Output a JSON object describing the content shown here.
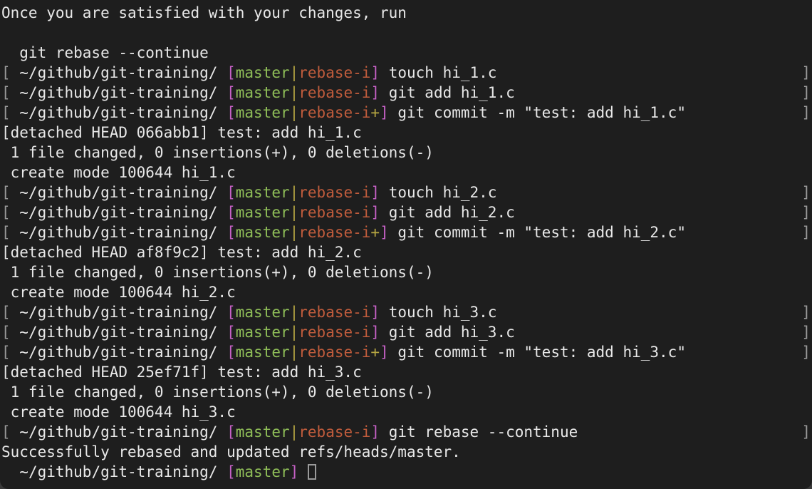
{
  "terminal": {
    "background_color": "#1e1e1e",
    "foreground_color": "#e8e8e8",
    "accent_colors": {
      "bracket_magenta": "#c661c6",
      "branch_green": "#8fbe58",
      "separator_olive": "#b5a642",
      "rebase_rust": "#c05c3c",
      "apple_purple": "#bf55c4",
      "edge_grey": "#9a9a9a"
    },
    "prompt": {
      "left_bracket": "[",
      "apple_icon": "",
      "path": "~/github/git-training/",
      "branch_open": "[",
      "branch": "master",
      "branch_sep": "|",
      "rebase_state": "rebase-i",
      "dirty_marker": "+",
      "branch_close": "]",
      "right_bracket": "]"
    },
    "cursor": "block-cursor",
    "lines": [
      {
        "name": "hint-line-1",
        "kind": "output",
        "text": "Once you are satisfied with your changes, run"
      },
      {
        "name": "blank-line-1",
        "kind": "blank",
        "text": ""
      },
      {
        "name": "hint-command",
        "kind": "output",
        "text": "  git rebase --continue"
      },
      {
        "name": "prompt-touch-1",
        "kind": "prompt",
        "dirty": false,
        "command": "touch hi_1.c"
      },
      {
        "name": "prompt-add-1",
        "kind": "prompt",
        "dirty": false,
        "command": "git add hi_1.c"
      },
      {
        "name": "prompt-commit-1",
        "kind": "prompt",
        "dirty": true,
        "command": "git commit -m \"test: add hi_1.c\""
      },
      {
        "name": "output-detached-1",
        "kind": "output",
        "text": "[detached HEAD 066abb1] test: add hi_1.c"
      },
      {
        "name": "output-changed-1",
        "kind": "output",
        "text": " 1 file changed, 0 insertions(+), 0 deletions(-)"
      },
      {
        "name": "output-createmode-1",
        "kind": "output",
        "text": " create mode 100644 hi_1.c"
      },
      {
        "name": "prompt-touch-2",
        "kind": "prompt",
        "dirty": false,
        "command": "touch hi_2.c"
      },
      {
        "name": "prompt-add-2",
        "kind": "prompt",
        "dirty": false,
        "command": "git add hi_2.c"
      },
      {
        "name": "prompt-commit-2",
        "kind": "prompt",
        "dirty": true,
        "command": "git commit -m \"test: add hi_2.c\""
      },
      {
        "name": "output-detached-2",
        "kind": "output",
        "text": "[detached HEAD af8f9c2] test: add hi_2.c"
      },
      {
        "name": "output-changed-2",
        "kind": "output",
        "text": " 1 file changed, 0 insertions(+), 0 deletions(-)"
      },
      {
        "name": "output-createmode-2",
        "kind": "output",
        "text": " create mode 100644 hi_2.c"
      },
      {
        "name": "prompt-touch-3",
        "kind": "prompt",
        "dirty": false,
        "command": "touch hi_3.c"
      },
      {
        "name": "prompt-add-3",
        "kind": "prompt",
        "dirty": false,
        "command": "git add hi_3.c"
      },
      {
        "name": "prompt-commit-3",
        "kind": "prompt",
        "dirty": true,
        "command": "git commit -m \"test: add hi_3.c\""
      },
      {
        "name": "output-detached-3",
        "kind": "output",
        "text": "[detached HEAD 25ef71f] test: add hi_3.c"
      },
      {
        "name": "output-changed-3",
        "kind": "output",
        "text": " 1 file changed, 0 insertions(+), 0 deletions(-)"
      },
      {
        "name": "output-createmode-3",
        "kind": "output",
        "text": " create mode 100644 hi_3.c"
      },
      {
        "name": "prompt-rebase-continue",
        "kind": "prompt",
        "dirty": false,
        "command": "git rebase --continue"
      },
      {
        "name": "output-success",
        "kind": "output",
        "text": "Successfully rebased and updated refs/heads/master."
      },
      {
        "name": "prompt-final",
        "kind": "prompt-final",
        "dirty": false,
        "command": ""
      }
    ]
  }
}
